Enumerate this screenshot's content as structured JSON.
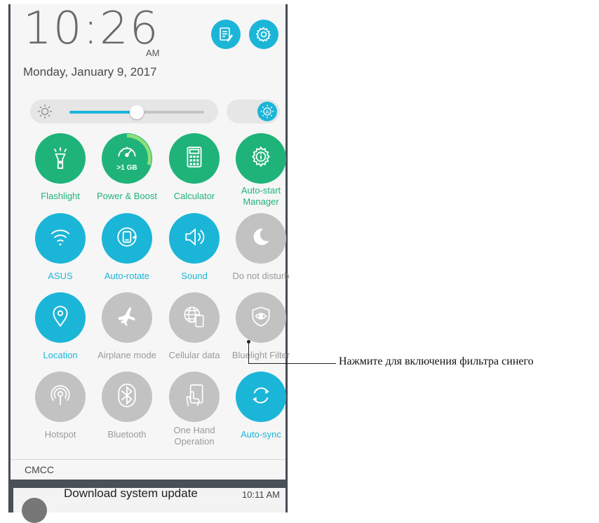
{
  "header": {
    "time": "10:26",
    "ampm": "AM",
    "date": "Monday, January 9, 2017"
  },
  "brightness": {
    "level": 0.5
  },
  "colors": {
    "active": "#1bb5d8",
    "green": "#1fb37a",
    "inactive": "#c2c2c2"
  },
  "tiles": [
    {
      "label": "Flashlight",
      "icon": "flashlight-icon",
      "state": "green"
    },
    {
      "label": "Power & Boost",
      "icon": "speedometer-icon",
      "state": "green",
      "badge": ">1 GB"
    },
    {
      "label": "Calculator",
      "icon": "calculator-icon",
      "state": "green"
    },
    {
      "label": "Auto-start Manager",
      "icon": "gear-info-icon",
      "state": "green"
    },
    {
      "label": "ASUS",
      "icon": "wifi-icon",
      "state": "active"
    },
    {
      "label": "Auto-rotate",
      "icon": "rotate-icon",
      "state": "active"
    },
    {
      "label": "Sound",
      "icon": "speaker-icon",
      "state": "active"
    },
    {
      "label": "Do not disturb",
      "icon": "moon-icon",
      "state": "inactive"
    },
    {
      "label": "Location",
      "icon": "location-pin-icon",
      "state": "active"
    },
    {
      "label": "Airplane mode",
      "icon": "airplane-icon",
      "state": "inactive"
    },
    {
      "label": "Cellular data",
      "icon": "globe-phone-icon",
      "state": "inactive"
    },
    {
      "label": "Bluelight Filter",
      "icon": "eye-shield-icon",
      "state": "inactive"
    },
    {
      "label": "Hotspot",
      "icon": "hotspot-icon",
      "state": "inactive"
    },
    {
      "label": "Bluetooth",
      "icon": "bluetooth-icon",
      "state": "inactive"
    },
    {
      "label": "One Hand Operation",
      "icon": "one-hand-icon",
      "state": "inactive"
    },
    {
      "label": "Auto-sync",
      "icon": "sync-icon",
      "state": "active"
    }
  ],
  "carrier": "CMCC",
  "notification": {
    "title": "Download system update",
    "time": "10:11 AM"
  },
  "callout": "Нажмите для включения фильтра синего"
}
